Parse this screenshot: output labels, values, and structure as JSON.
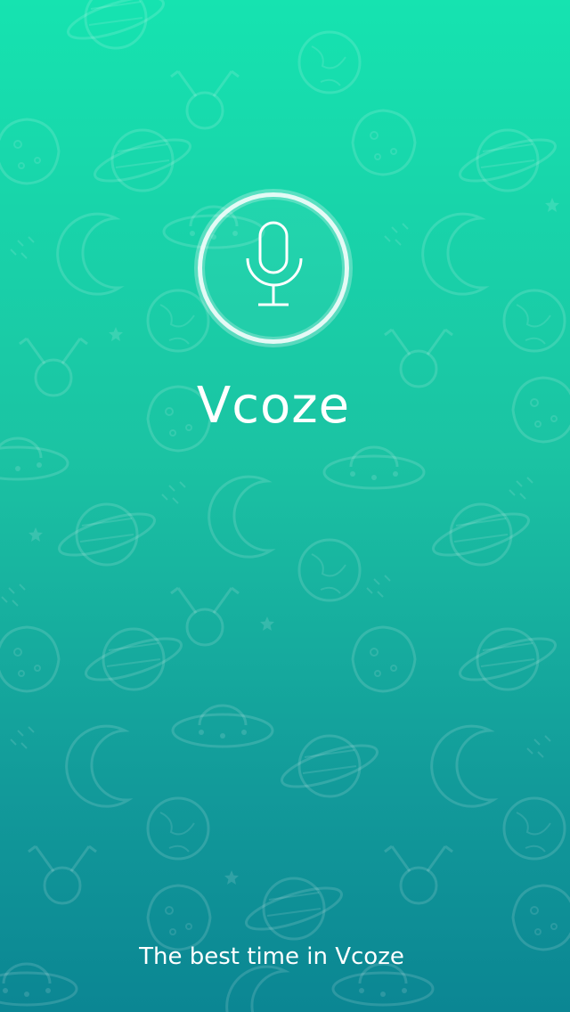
{
  "splash": {
    "app_name": "Vcoze",
    "tagline": "The best time in Vcoze",
    "icon": "microphone-icon",
    "background_pattern": "space-doodle-pattern"
  },
  "colors": {
    "gradient_top": "#16e3b0",
    "gradient_mid": "#1bc3a3",
    "gradient_bottom": "#0b8693",
    "foreground": "#ffffff"
  }
}
